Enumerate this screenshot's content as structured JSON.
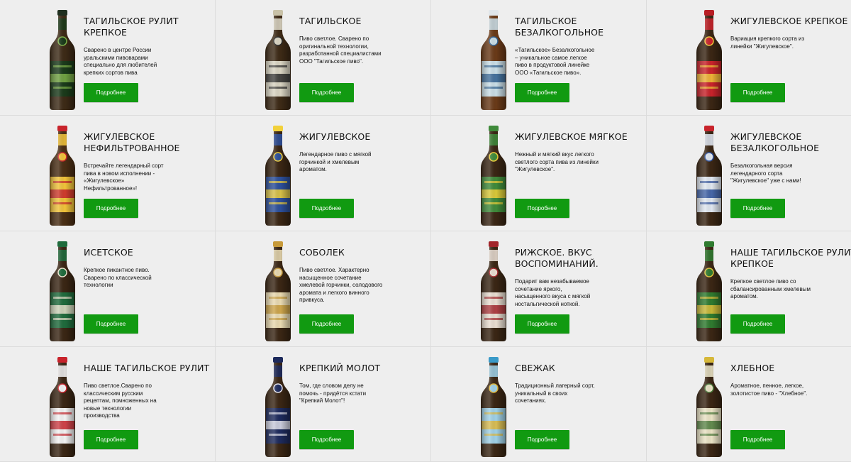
{
  "products": [
    {
      "title": "Тагильское Рулит Крепкое",
      "description": "Сварено в центре России уральскими пивоварами специально для любителей крепких сортов пива",
      "button": "Подробнее",
      "glass": "#3d2a16",
      "label": "#1a3a1a",
      "accent": "#7fb34a",
      "cap": "#1f2f1f"
    },
    {
      "title": "Тагильское",
      "description": "Пиво светлое. Сварено по оригинальной технологии, разработанной специалистами ООО \"Тагильское пиво\".",
      "button": "Подробнее",
      "glass": "#3d2a16",
      "label": "#d9d4c2",
      "accent": "#2a2a2a",
      "cap": "#c9c2a8"
    },
    {
      "title": "Тагильское безалкогольное",
      "description": "«Тагильское» Безалкогольное – уникальное самое легкое пиво в продуктовой линейке ООО «Тагильское пиво».",
      "button": "Подробнее",
      "glass": "#6a3a18",
      "label": "#c9dde6",
      "accent": "#2f5f8f",
      "cap": "#e0e6ea"
    },
    {
      "title": "Жигулевское Крепкое",
      "description": "Вариация крепкого сорта из линейки \"Жигулевское\".",
      "button": "Подробнее",
      "glass": "#3a2614",
      "label": "#c8232b",
      "accent": "#f2c83a",
      "cap": "#b81e24"
    },
    {
      "title": "Жигулевское нефильтрованное",
      "description": "Встречайте легендарный сорт пива в новом исполнении - «Жигулевское» Нефильтрованное»!",
      "button": "Подробнее",
      "glass": "#4a2e14",
      "label": "#f0c23a",
      "accent": "#c8232b",
      "cap": "#c8232b"
    },
    {
      "title": "Жигулевское",
      "description": "Легендарное пиво с мягкой горчинкой и хмелевым ароматом.",
      "button": "Подробнее",
      "glass": "#3a2614",
      "label": "#2c4f9a",
      "accent": "#f2d13a",
      "cap": "#f2d13a"
    },
    {
      "title": "Жигулевское мягкое",
      "description": "Нежный и мягкий вкус легкого светлого сорта пива из линейки \"Жигулевское\".",
      "button": "Подробнее",
      "glass": "#3a2614",
      "label": "#3f8a3a",
      "accent": "#f2d13a",
      "cap": "#3f8a3a"
    },
    {
      "title": "Жигулевское безалкогольное",
      "description": "Безалкогольная версия легендарного сорта \"Жигулевское\" уже с нами!",
      "button": "Подробнее",
      "glass": "#3a2614",
      "label": "#dfe6ef",
      "accent": "#2c4f9a",
      "cap": "#c8232b"
    },
    {
      "title": "Исетское",
      "description": "Крепкое пикантное пиво. Сварено по классической технологии",
      "button": "Подробнее",
      "glass": "#3a2614",
      "label": "#1f6b3c",
      "accent": "#e9e3cc",
      "cap": "#1f6b3c"
    },
    {
      "title": "Соболек",
      "description": "Пиво светлое. Характерно насыщенное сочетание хмелевой горчинки, солодового аромата и легкого винного привкуса.",
      "button": "Подробнее",
      "glass": "#3a2614",
      "label": "#e8d9b0",
      "accent": "#c79a3a",
      "cap": "#c79a3a"
    },
    {
      "title": "Рижское. Вкус воспоминаний.",
      "description": "Подарит вам незабываемое сочетание яркого, насыщенного вкуса с мягкой ностальгической ноткой.",
      "button": "Подробнее",
      "glass": "#3a2614",
      "label": "#e8ddd0",
      "accent": "#a2252a",
      "cap": "#a2252a"
    },
    {
      "title": "Наше Тагильское Рулит Крепкое",
      "description": "Крепкое светлое пиво со сбалансированным хмелевым ароматом.",
      "button": "Подробнее",
      "glass": "#3a2614",
      "label": "#2f7a2f",
      "accent": "#e0c23a",
      "cap": "#2f7a2f"
    },
    {
      "title": "Наше Тагильское Рулит",
      "description": "Пиво светлое.Сварено по классическим русским рецептам, помноженных на новые технологии производства",
      "button": "Подробнее",
      "glass": "#3a2614",
      "label": "#f2f2f2",
      "accent": "#c8232b",
      "cap": "#c8232b"
    },
    {
      "title": "Крепкий Молот",
      "description": "Том, где словом делу не помочь - придётся кстати \"Крепкий Молот\"!",
      "button": "Подробнее",
      "glass": "#3a2614",
      "label": "#1d2a5c",
      "accent": "#e6e6f0",
      "cap": "#1d2a5c"
    },
    {
      "title": "Свежак",
      "description": "Традиционный лагерный сорт, уникальный в своих сочетаниях.",
      "button": "Подробнее",
      "glass": "#3a2614",
      "label": "#9fd0e6",
      "accent": "#e0b83a",
      "cap": "#3a9ac8"
    },
    {
      "title": "Хлебное",
      "description": "Ароматное, пенное, легкое, золотистое пиво - \"Хлебное\".",
      "button": "Подробнее",
      "glass": "#3a2614",
      "label": "#e9e2c4",
      "accent": "#4a7a3a",
      "cap": "#d6b83a"
    }
  ]
}
